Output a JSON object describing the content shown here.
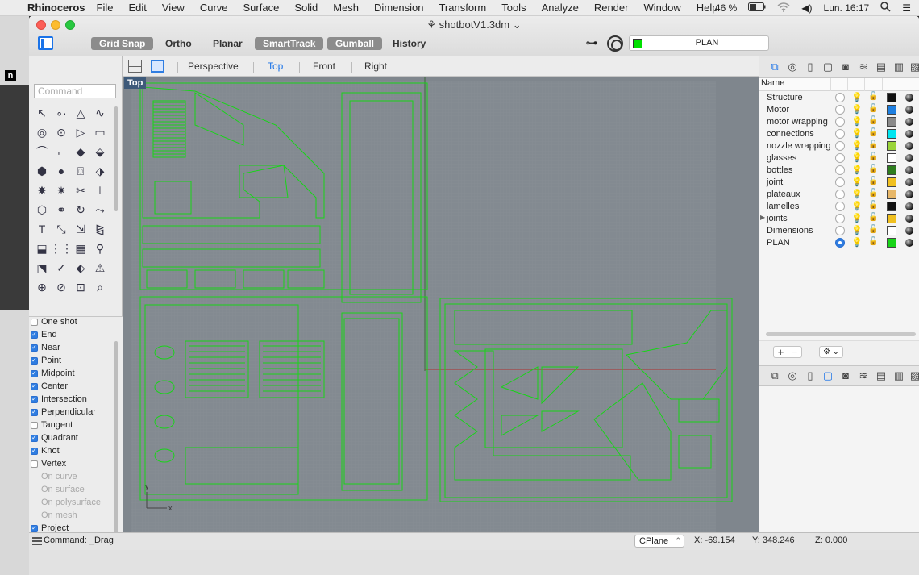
{
  "menubar": {
    "app": "Rhinoceros",
    "items": [
      "File",
      "Edit",
      "View",
      "Curve",
      "Surface",
      "Solid",
      "Mesh",
      "Dimension",
      "Transform",
      "Tools",
      "Analyze",
      "Render",
      "Window",
      "Help"
    ],
    "battery": "46 %",
    "clock": "Lun. 16:17"
  },
  "window": {
    "title": "shotbotV1.3dm",
    "toggles": [
      {
        "label": "Grid Snap",
        "on": true
      },
      {
        "label": "Ortho",
        "on": false
      },
      {
        "label": "Planar",
        "on": false
      },
      {
        "label": "SmartTrack",
        "on": true
      },
      {
        "label": "Gumball",
        "on": true
      },
      {
        "label": "History",
        "on": false
      }
    ],
    "current_layer": "PLAN"
  },
  "sidebar": {
    "command_placeholder": "Command",
    "osnaps": [
      {
        "label": "One shot",
        "checked": false,
        "enabled": true
      },
      {
        "label": "End",
        "checked": true,
        "enabled": true
      },
      {
        "label": "Near",
        "checked": true,
        "enabled": true
      },
      {
        "label": "Point",
        "checked": true,
        "enabled": true
      },
      {
        "label": "Midpoint",
        "checked": true,
        "enabled": true
      },
      {
        "label": "Center",
        "checked": true,
        "enabled": true
      },
      {
        "label": "Intersection",
        "checked": true,
        "enabled": true
      },
      {
        "label": "Perpendicular",
        "checked": true,
        "enabled": true
      },
      {
        "label": "Tangent",
        "checked": false,
        "enabled": true
      },
      {
        "label": "Quadrant",
        "checked": true,
        "enabled": true
      },
      {
        "label": "Knot",
        "checked": true,
        "enabled": true
      },
      {
        "label": "Vertex",
        "checked": false,
        "enabled": true
      },
      {
        "label": "On curve",
        "checked": false,
        "enabled": false
      },
      {
        "label": "On surface",
        "checked": false,
        "enabled": false
      },
      {
        "label": "On polysurface",
        "checked": false,
        "enabled": false
      },
      {
        "label": "On mesh",
        "checked": false,
        "enabled": false
      },
      {
        "label": "Project",
        "checked": true,
        "enabled": true
      }
    ]
  },
  "viewport_tabs": {
    "tabs": [
      "Perspective",
      "Top",
      "Front",
      "Right"
    ],
    "active": "Top"
  },
  "viewport": {
    "label": "Top",
    "axis_x": "x",
    "axis_y": "y",
    "curve_color": "#18d418",
    "background": "#7f868d"
  },
  "layers": {
    "column_name": "Name",
    "items": [
      {
        "name": "Structure",
        "color": "#111111",
        "current": false,
        "has_children": false
      },
      {
        "name": "Motor",
        "color": "#1e7fe0",
        "current": false,
        "has_children": false
      },
      {
        "name": "motor wrapping",
        "color": "#8a8a8a",
        "current": false,
        "has_children": false
      },
      {
        "name": "connections",
        "color": "#00e5f0",
        "current": false,
        "has_children": false
      },
      {
        "name": "nozzle wrapping",
        "color": "#9ad43a",
        "current": false,
        "has_children": false
      },
      {
        "name": "glasses",
        "color": "#ffffff",
        "current": false,
        "has_children": false
      },
      {
        "name": "bottles",
        "color": "#2e7d1e",
        "current": false,
        "has_children": false
      },
      {
        "name": "joint",
        "color": "#f0c020",
        "current": false,
        "has_children": false
      },
      {
        "name": "plateaux",
        "color": "#e7b769",
        "current": false,
        "has_children": false
      },
      {
        "name": "lamelles",
        "color": "#111111",
        "current": false,
        "has_children": false
      },
      {
        "name": "joints",
        "color": "#f0c020",
        "current": false,
        "has_children": true
      },
      {
        "name": "Dimensions",
        "color": "#ffffff",
        "current": false,
        "has_children": false
      },
      {
        "name": "PLAN",
        "color": "#18d418",
        "current": true,
        "has_children": false
      }
    ]
  },
  "statusbar": {
    "command": "Command: _Drag",
    "cplane": "CPlane",
    "x": "X: -69.154",
    "y": "Y: 348.246",
    "z": "Z: 0.000"
  }
}
